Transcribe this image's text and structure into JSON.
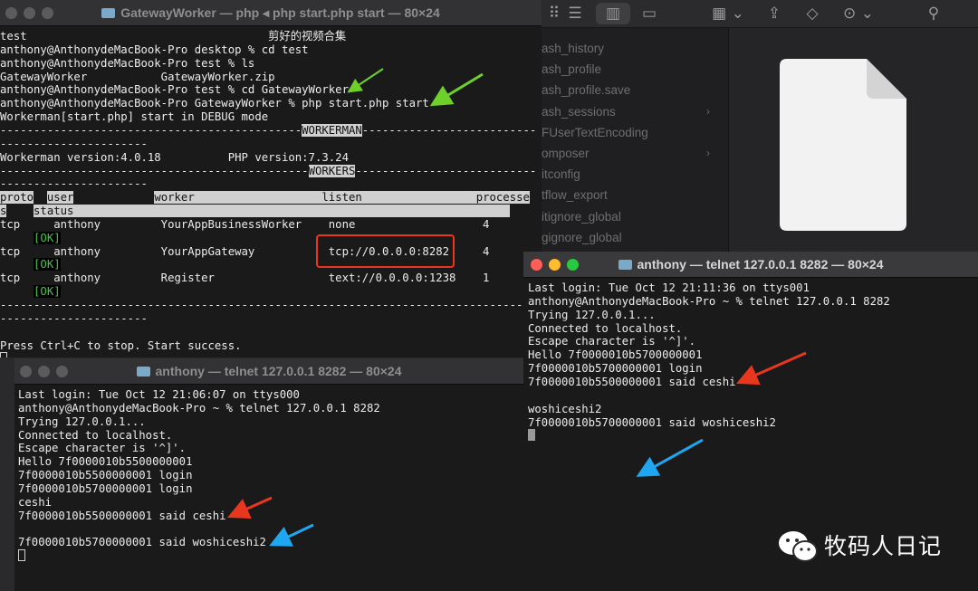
{
  "finder": {
    "items": [
      {
        "label": "ash_history",
        "chevron": false
      },
      {
        "label": "ash_profile",
        "chevron": false
      },
      {
        "label": "ash_profile.save",
        "chevron": false
      },
      {
        "label": "ash_sessions",
        "chevron": true
      },
      {
        "label": "FUserTextEncoding",
        "chevron": false
      },
      {
        "label": "omposer",
        "chevron": true
      },
      {
        "label": "itconfig",
        "chevron": false
      },
      {
        "label": "tflow_export",
        "chevron": false
      },
      {
        "label": "itignore_global",
        "chevron": false
      },
      {
        "label": "gignore_global",
        "chevron": false
      }
    ]
  },
  "term1": {
    "title": "GatewayWorker — php ◂ php start.php start — 80×24",
    "lines": [
      {
        "segs": [
          {
            "t": "test                                    剪好的视频合集"
          }
        ]
      },
      {
        "segs": [
          {
            "t": "anthony@AnthonydeMacBook-Pro desktop % cd test"
          }
        ]
      },
      {
        "segs": [
          {
            "t": "anthony@AnthonydeMacBook-Pro test % ls"
          }
        ]
      },
      {
        "segs": [
          {
            "t": "GatewayWorker           GatewayWorker.zip"
          }
        ]
      },
      {
        "segs": [
          {
            "t": "anthony@AnthonydeMacBook-Pro test % cd GatewayWorker"
          }
        ]
      },
      {
        "segs": [
          {
            "t": "anthony@AnthonydeMacBook-Pro GatewayWorker % php start.php start"
          }
        ]
      },
      {
        "segs": [
          {
            "t": "Workerman[start.php] start in DEBUG mode"
          }
        ]
      },
      {
        "segs": [
          {
            "t": "---------------------------------------------"
          },
          {
            "t": "WORKERMAN",
            "c": "hl"
          },
          {
            "t": "--------------------------"
          }
        ]
      },
      {
        "segs": [
          {
            "t": "----------------------"
          }
        ]
      },
      {
        "segs": [
          {
            "t": "Workerman version:4.0.18          PHP version:7.3.24"
          }
        ]
      },
      {
        "segs": [
          {
            "t": "----------------------------------------------"
          },
          {
            "t": "WORKERS",
            "c": "hl"
          },
          {
            "t": "---------------------------"
          }
        ]
      },
      {
        "segs": [
          {
            "t": "----------------------"
          }
        ]
      },
      {
        "segs": [
          {
            "t": "proto",
            "c": "hl"
          },
          {
            "t": "  "
          },
          {
            "t": "user",
            "c": "hl"
          },
          {
            "t": "            "
          },
          {
            "t": "worker                   ",
            "c": "hl"
          },
          {
            "t": "listen                 ",
            "c": "hl"
          },
          {
            "t": "processe",
            "c": "hl"
          }
        ]
      },
      {
        "segs": [
          {
            "t": "s",
            "c": "hl"
          },
          {
            "t": "    "
          },
          {
            "t": "status",
            "c": "hl"
          },
          {
            "t": "                                                                 ",
            "c": "hl"
          }
        ]
      },
      {
        "segs": [
          {
            "t": "tcp     anthony         YourAppBusinessWorker    none                   4"
          }
        ]
      },
      {
        "segs": [
          {
            "t": "     "
          },
          {
            "t": "[OK]",
            "c": "ok"
          }
        ]
      },
      {
        "segs": [
          {
            "t": "tcp     anthony         YourAppGateway           tcp://0.0.0.0:8282     4"
          }
        ]
      },
      {
        "segs": [
          {
            "t": "     "
          },
          {
            "t": "[OK]",
            "c": "ok"
          }
        ]
      },
      {
        "segs": [
          {
            "t": "tcp     anthony         Register                 text://0.0.0.0:1238    1"
          }
        ]
      },
      {
        "segs": [
          {
            "t": "     "
          },
          {
            "t": "[OK]",
            "c": "ok"
          }
        ]
      },
      {
        "segs": [
          {
            "t": "--------------------------------------------------------------------------------"
          }
        ]
      },
      {
        "segs": [
          {
            "t": "----------------------"
          }
        ]
      },
      {
        "segs": [
          {
            "t": ""
          }
        ]
      },
      {
        "segs": [
          {
            "t": "Press Ctrl+C to stop. Start success."
          }
        ]
      }
    ]
  },
  "term2": {
    "title": "anthony — telnet 127.0.0.1 8282 — 80×24",
    "lines": [
      "Last login: Tue Oct 12 21:06:07 on ttys000",
      "anthony@AnthonydeMacBook-Pro ~ % telnet 127.0.0.1 8282",
      "Trying 127.0.0.1...",
      "Connected to localhost.",
      "Escape character is '^]'.",
      "Hello 7f0000010b5500000001",
      "7f0000010b5500000001 login",
      "7f0000010b5700000001 login",
      "ceshi",
      "7f0000010b5500000001 said ceshi",
      "",
      "7f0000010b5700000001 said woshiceshi2",
      ""
    ]
  },
  "term3": {
    "title": "anthony — telnet 127.0.0.1 8282 — 80×24",
    "lines": [
      "Last login: Tue Oct 12 21:11:36 on ttys001",
      "anthony@AnthonydeMacBook-Pro ~ % telnet 127.0.0.1 8282",
      "Trying 127.0.0.1...",
      "Connected to localhost.",
      "Escape character is '^]'.",
      "Hello 7f0000010b5700000001",
      "7f0000010b5700000001 login",
      "7f0000010b5500000001 said ceshi",
      "",
      "woshiceshi2",
      "7f0000010b5700000001 said woshiceshi2",
      ""
    ]
  },
  "watermark": {
    "text": "牧码人日记"
  },
  "colors": {
    "red_arrow": "#e8361f",
    "green_arrow": "#6ed12a",
    "blue_arrow": "#1ea6f0",
    "traffic_red": "#ff5f57",
    "traffic_yellow": "#febc2e",
    "traffic_green": "#28c840"
  }
}
